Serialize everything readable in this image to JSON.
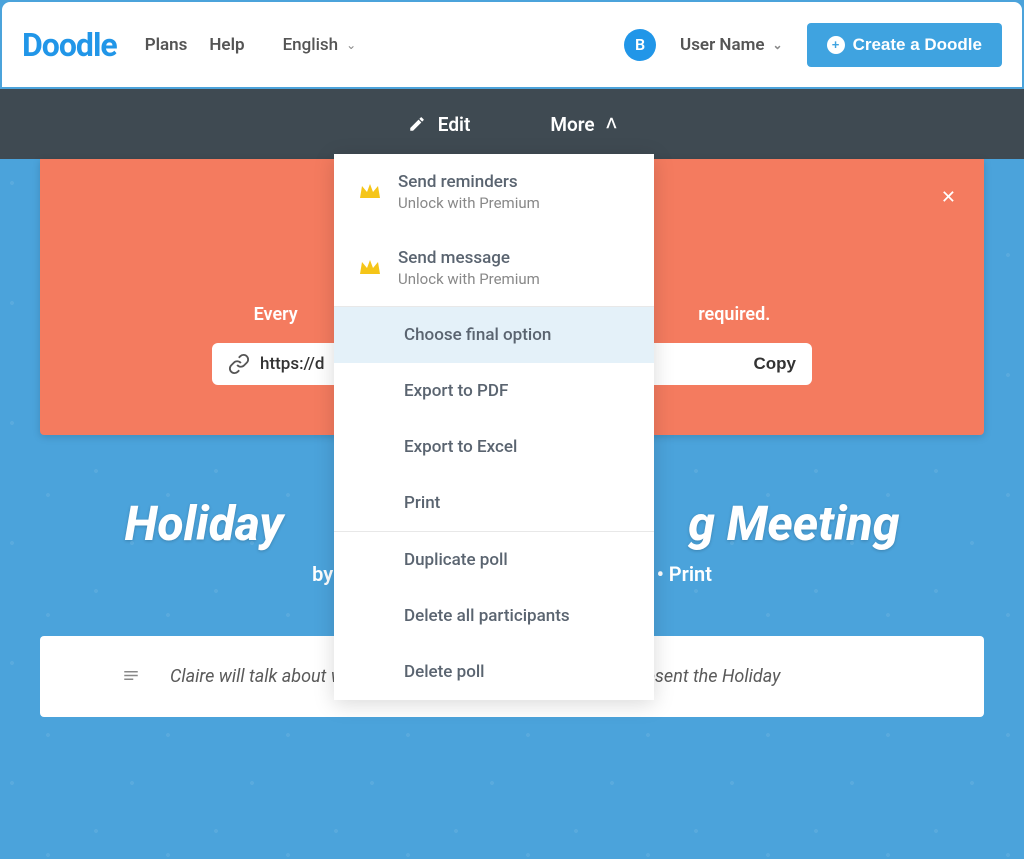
{
  "header": {
    "logo": "Doodle",
    "nav": {
      "plans": "Plans",
      "help": "Help"
    },
    "language": "English",
    "avatar_initial": "B",
    "user_name": "User Name",
    "create_button": "Create a Doodle"
  },
  "toolbar": {
    "edit": "Edit",
    "more": "More"
  },
  "dropdown": {
    "send_reminders": {
      "title": "Send reminders",
      "subtitle": "Unlock with Premium"
    },
    "send_message": {
      "title": "Send message",
      "subtitle": "Unlock with Premium"
    },
    "choose_final": "Choose final option",
    "export_pdf": "Export to PDF",
    "export_excel": "Export to Excel",
    "print": "Print",
    "duplicate": "Duplicate poll",
    "delete_participants": "Delete all participants",
    "delete_poll": "Delete poll"
  },
  "coral": {
    "dots": "..",
    "text_left": "Every",
    "text_right": "required.",
    "url": "https://d",
    "copy": "Copy"
  },
  "poll": {
    "title_left": "Holiday",
    "title_right": "g Meeting",
    "by": "by",
    "print_suffix": "• Print"
  },
  "description": {
    "text": "Claire will talk about what she learned at corporate and will present the Holiday"
  }
}
